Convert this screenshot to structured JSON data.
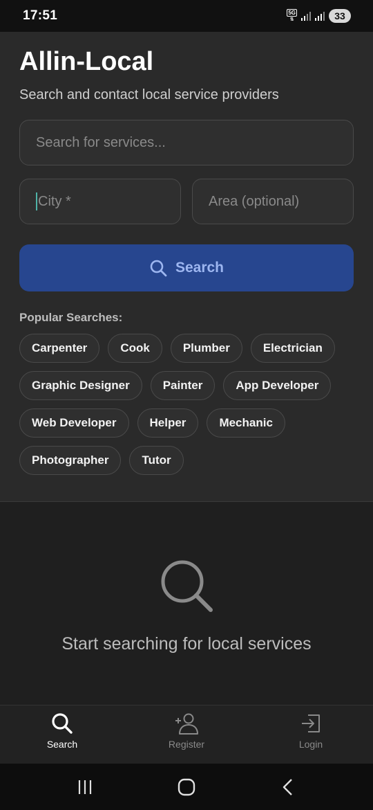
{
  "status_bar": {
    "time": "17:51",
    "network": "5G",
    "battery": "33"
  },
  "header": {
    "title": "Allin-Local",
    "subtitle": "Search and contact local service providers"
  },
  "form": {
    "search_placeholder": "Search for services...",
    "city_placeholder": "City *",
    "area_placeholder": "Area (optional)",
    "search_button_label": "Search"
  },
  "popular": {
    "label": "Popular Searches:",
    "items": [
      "Carpenter",
      "Cook",
      "Plumber",
      "Electrician",
      "Graphic Designer",
      "Painter",
      "App Developer",
      "Web Developer",
      "Helper",
      "Mechanic",
      "Photographer",
      "Tutor"
    ]
  },
  "empty_state": {
    "message": "Start searching for local services",
    "icon": "search-icon"
  },
  "bottom_nav": {
    "items": [
      {
        "label": "Search",
        "icon": "search-icon",
        "active": true
      },
      {
        "label": "Register",
        "icon": "add-user-icon",
        "active": false
      },
      {
        "label": "Login",
        "icon": "login-icon",
        "active": false
      }
    ]
  },
  "colors": {
    "accent": "#27468f",
    "background": "#1f1f1f",
    "panel": "#2a2a2a"
  }
}
